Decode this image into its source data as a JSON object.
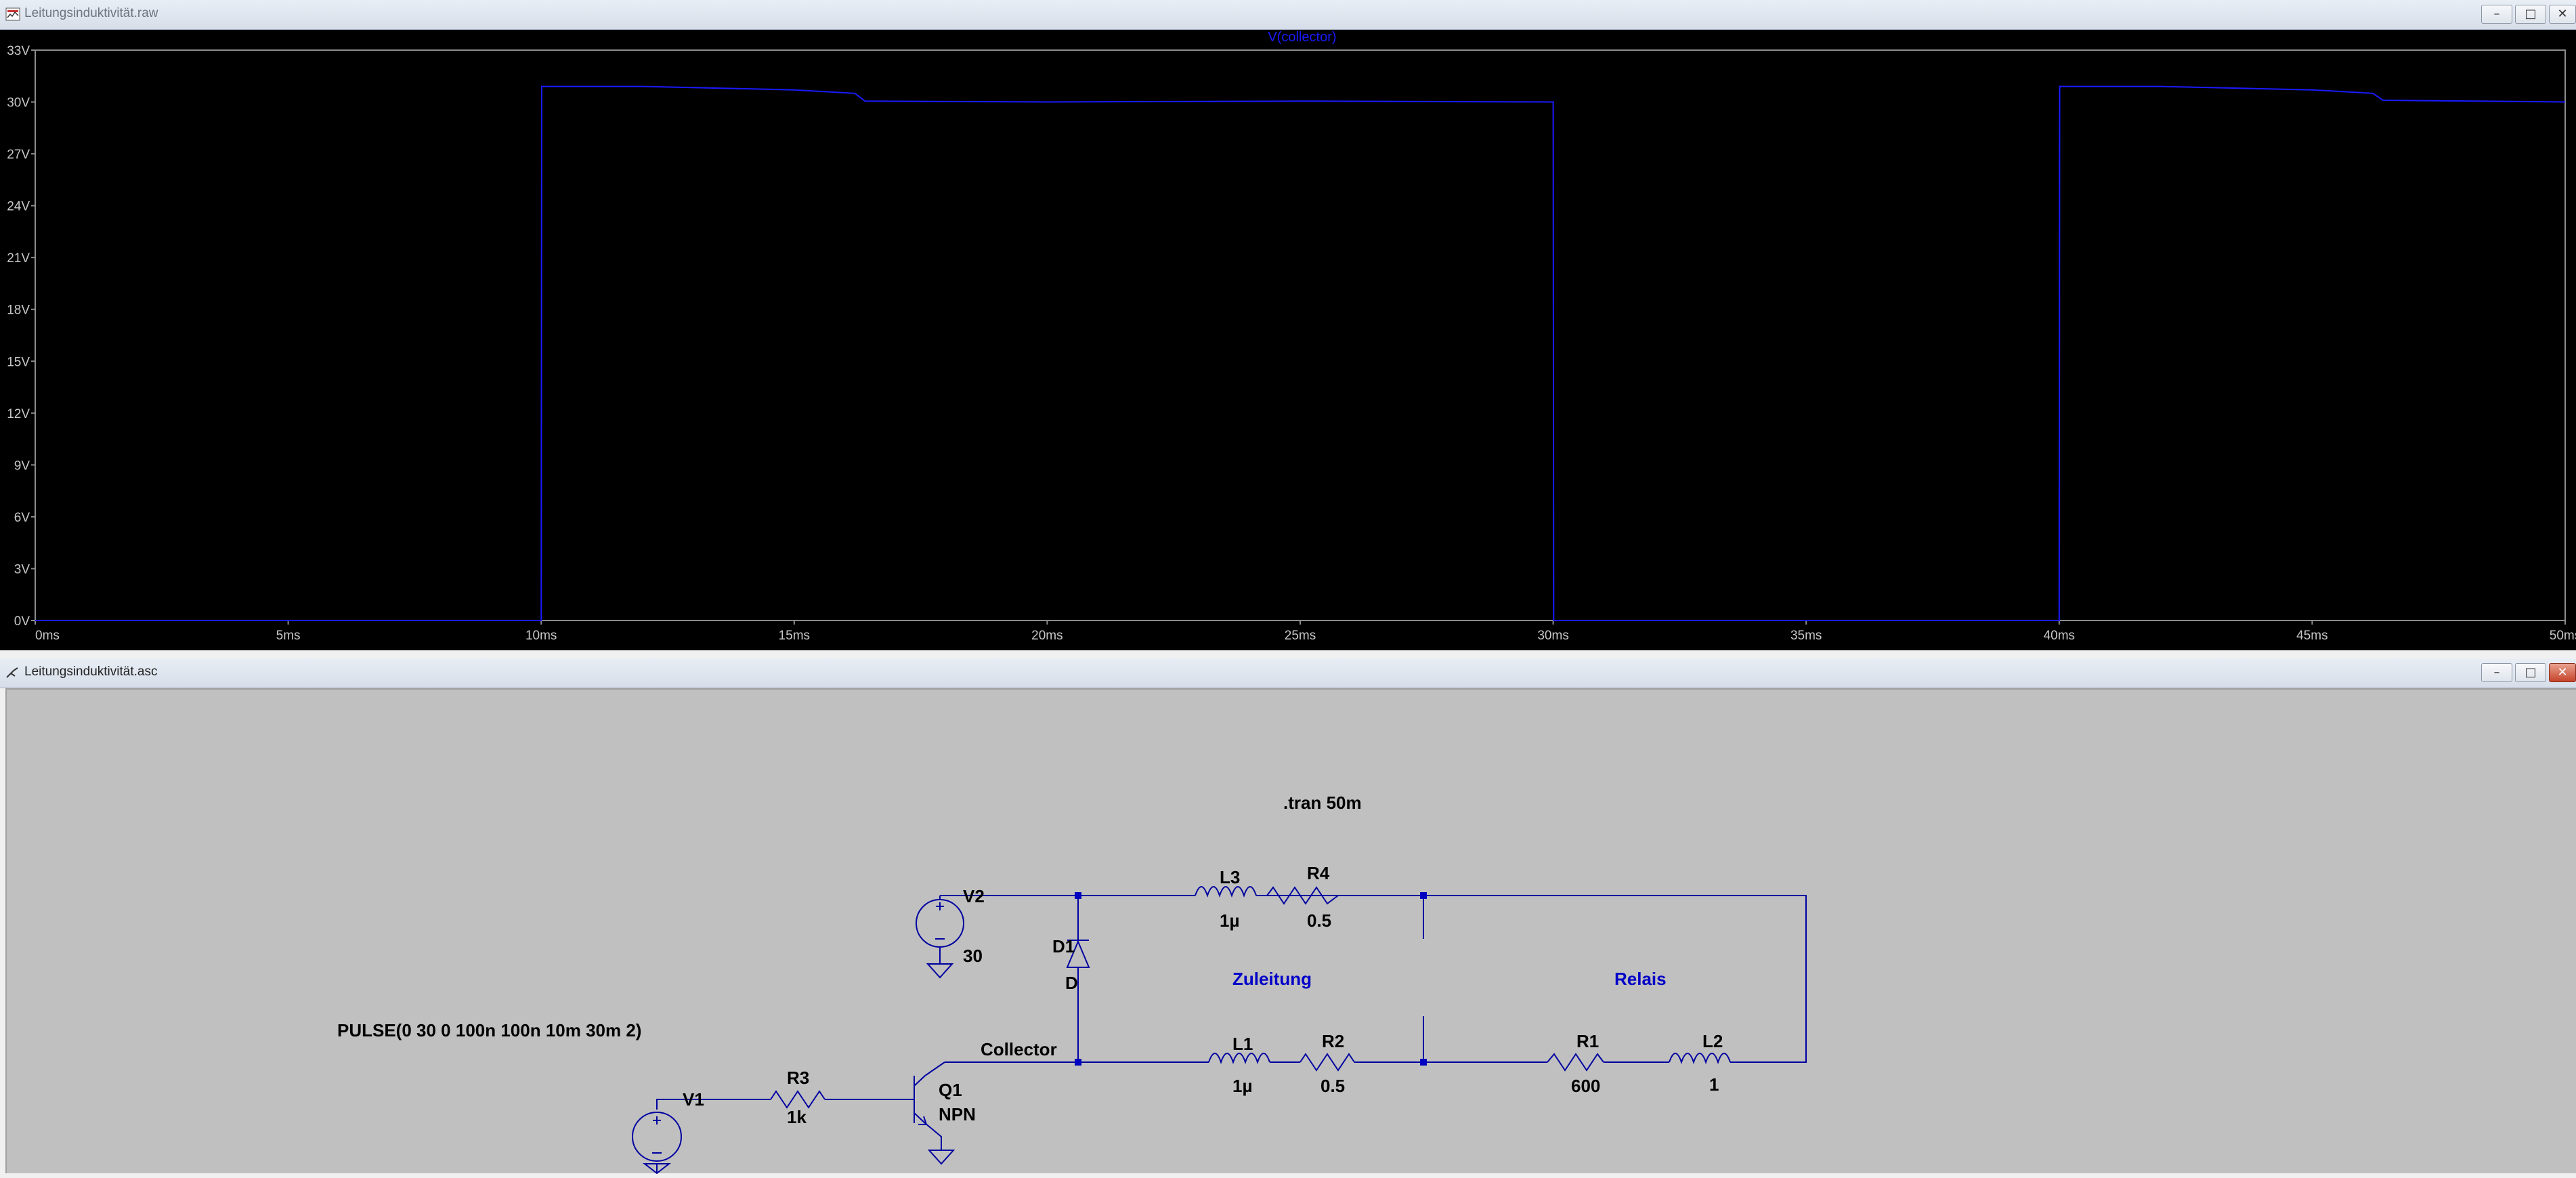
{
  "plot_window": {
    "title": "Leitungsinduktivität.raw",
    "trace_label": "V(collector)",
    "buttons": {
      "minimize": "–",
      "maximize": "□",
      "close": "✕"
    }
  },
  "schematic_window": {
    "title": "Leitungsinduktivität.asc",
    "buttons": {
      "minimize": "–",
      "maximize": "□",
      "close": "✕"
    },
    "directive": ".tran 50m",
    "pulse_text": "PULSE(0 30 0 100n 100n 10m 30m 2)",
    "net_label": "Collector",
    "comments": [
      "Zuleitung",
      "Relais"
    ],
    "components": [
      {
        "ref": "V2",
        "value": "30"
      },
      {
        "ref": "D1",
        "value": "D"
      },
      {
        "ref": "L3",
        "value": "1µ"
      },
      {
        "ref": "R4",
        "value": "0.5"
      },
      {
        "ref": "L1",
        "value": "1µ"
      },
      {
        "ref": "R2",
        "value": "0.5"
      },
      {
        "ref": "R1",
        "value": "600"
      },
      {
        "ref": "L2",
        "value": "1"
      },
      {
        "ref": "R3",
        "value": "1k"
      },
      {
        "ref": "Q1",
        "value": "NPN"
      },
      {
        "ref": "V1",
        "value": ""
      }
    ]
  },
  "chart_data": {
    "type": "line",
    "title": "V(collector)",
    "xlabel": "",
    "ylabel": "",
    "x_ticks": [
      "0ms",
      "5ms",
      "10ms",
      "15ms",
      "20ms",
      "25ms",
      "30ms",
      "35ms",
      "40ms",
      "45ms",
      "50ms"
    ],
    "y_ticks": [
      "0V",
      "3V",
      "6V",
      "9V",
      "12V",
      "15V",
      "18V",
      "21V",
      "24V",
      "27V",
      "30V",
      "33V"
    ],
    "xlim": [
      0,
      50
    ],
    "ylim": [
      0,
      33
    ],
    "colors": {
      "background": "#000000",
      "trace": "#1a1aff",
      "axis": "#8c8c8c",
      "text": "#c8c8c8"
    },
    "series": [
      {
        "name": "V(collector)",
        "x": [
          0,
          10,
          10.01,
          12,
          15,
          16.2,
          16.4,
          20,
          25,
          30,
          30.01,
          40,
          40.01,
          42,
          45,
          46.2,
          46.4,
          50
        ],
        "y": [
          0,
          0,
          30.9,
          30.9,
          30.7,
          30.5,
          30.05,
          30.0,
          30.05,
          30.0,
          0,
          0,
          30.9,
          30.9,
          30.7,
          30.5,
          30.1,
          30.0
        ]
      }
    ]
  }
}
